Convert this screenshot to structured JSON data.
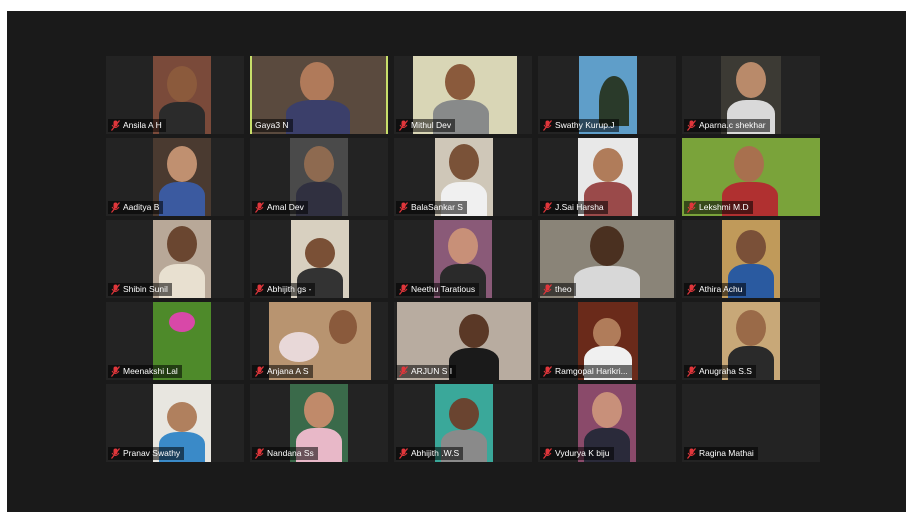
{
  "colors": {
    "window_bg": "#1a1a1a",
    "tile_bg": "#232323",
    "active_border": "#c8df6a",
    "mute_red": "#e0363b"
  },
  "participants": [
    {
      "name": "Ansila A H",
      "muted": true,
      "icon": "microphone-muted-icon"
    },
    {
      "name": "Gaya3 N",
      "muted": false,
      "active_speaker": true
    },
    {
      "name": "Mithul Dev",
      "muted": true,
      "icon": "microphone-muted-icon"
    },
    {
      "name": "Swathy Kurup.J",
      "muted": true,
      "icon": "microphone-muted-icon"
    },
    {
      "name": "Aparna.c shekhar",
      "muted": true,
      "icon": "microphone-muted-icon"
    },
    {
      "name": "Aaditya B",
      "muted": true,
      "icon": "microphone-muted-icon"
    },
    {
      "name": "Amal Dev",
      "muted": true,
      "icon": "microphone-muted-icon"
    },
    {
      "name": "BalaSankar S",
      "muted": true,
      "icon": "microphone-muted-icon"
    },
    {
      "name": "J.Sai Harsha",
      "muted": true,
      "icon": "microphone-muted-icon"
    },
    {
      "name": "Lekshmi M.D",
      "muted": true,
      "icon": "microphone-muted-icon"
    },
    {
      "name": "Shibin Sunil",
      "muted": true,
      "icon": "microphone-muted-icon"
    },
    {
      "name": "Abhijith gs -",
      "muted": true,
      "icon": "microphone-muted-icon"
    },
    {
      "name": "Neethu Taratious",
      "muted": true,
      "icon": "microphone-muted-icon"
    },
    {
      "name": "theo",
      "muted": true,
      "icon": "microphone-muted-icon"
    },
    {
      "name": "Athira Achu",
      "muted": true,
      "icon": "microphone-muted-icon"
    },
    {
      "name": "Meenakshi Lal",
      "muted": true,
      "icon": "microphone-muted-icon"
    },
    {
      "name": "Anjana A S",
      "muted": true,
      "icon": "microphone-muted-icon"
    },
    {
      "name": "ARJUN S I",
      "muted": true,
      "icon": "microphone-muted-icon"
    },
    {
      "name": "Ramgopal Harikri...",
      "muted": true,
      "icon": "microphone-muted-icon"
    },
    {
      "name": "Anugraha S.S",
      "muted": true,
      "icon": "microphone-muted-icon"
    },
    {
      "name": "Pranav Swathy",
      "muted": true,
      "icon": "microphone-muted-icon"
    },
    {
      "name": "Nandana Ss",
      "muted": true,
      "icon": "microphone-muted-icon"
    },
    {
      "name": "Abhijith .W.S",
      "muted": true,
      "icon": "microphone-muted-icon"
    },
    {
      "name": "Vydurya K biju",
      "muted": true,
      "icon": "microphone-muted-icon"
    },
    {
      "name": "Ragina Mathai",
      "muted": true,
      "icon": "microphone-muted-icon"
    }
  ]
}
